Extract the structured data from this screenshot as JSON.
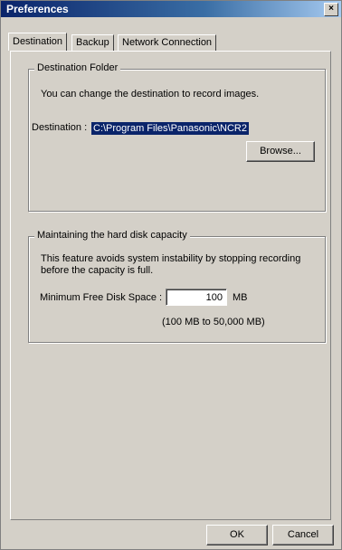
{
  "window": {
    "title": "Preferences",
    "close_label": "×"
  },
  "tabs": [
    {
      "label": "Destination",
      "active": true
    },
    {
      "label": "Backup",
      "active": false
    },
    {
      "label": "Network Connection",
      "active": false
    }
  ],
  "destination_folder": {
    "group_label": "Destination Folder",
    "description": "You can change the destination to record images.",
    "destination_label": "Destination :",
    "destination_value": "C:\\Program Files\\Panasonic\\NCR2",
    "browse_label": "Browse..."
  },
  "disk_capacity": {
    "group_label": "Maintaining the hard disk capacity",
    "description_line1": "This feature avoids system instability by stopping recording",
    "description_line2": "before the capacity is full.",
    "min_space_label": "Minimum Free Disk Space :",
    "min_space_value": "100",
    "unit": "MB",
    "range_text": "(100 MB to 50,000 MB)"
  },
  "footer": {
    "ok_label": "OK",
    "cancel_label": "Cancel"
  }
}
